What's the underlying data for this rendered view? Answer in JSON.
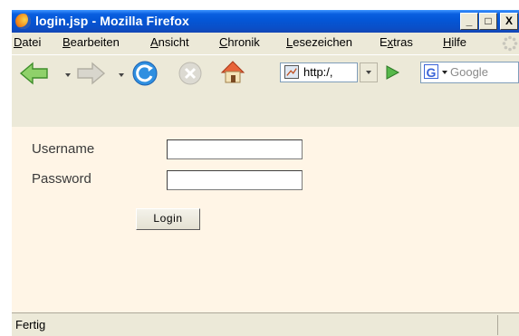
{
  "window": {
    "title": "login.jsp - Mozilla Firefox",
    "controls": {
      "minimize": "_",
      "maximize": "□",
      "close": "X"
    }
  },
  "menubar": {
    "items": [
      {
        "label_pre": "",
        "label_key": "D",
        "label_post": "atei"
      },
      {
        "label_pre": "",
        "label_key": "B",
        "label_post": "earbeiten"
      },
      {
        "label_pre": "",
        "label_key": "A",
        "label_post": "nsicht"
      },
      {
        "label_pre": "",
        "label_key": "C",
        "label_post": "hronik"
      },
      {
        "label_pre": "",
        "label_key": "L",
        "label_post": "esezeichen"
      },
      {
        "label_pre": "E",
        "label_key": "x",
        "label_post": "tras"
      },
      {
        "label_pre": "",
        "label_key": "H",
        "label_post": "ilfe"
      }
    ]
  },
  "toolbar": {
    "url": "http:/,",
    "search_placeholder": "Google",
    "search_engine_letter": "G"
  },
  "form": {
    "username_label": "Username",
    "password_label": "Password",
    "username_value": "",
    "password_value": "",
    "login_label": "Login"
  },
  "status": {
    "text": "Fertig"
  },
  "colors": {
    "titlebar": "#0a5fe0",
    "chrome": "#ece9d8",
    "content_bg": "#fff5e6",
    "label_text": "#3a3a3a"
  }
}
